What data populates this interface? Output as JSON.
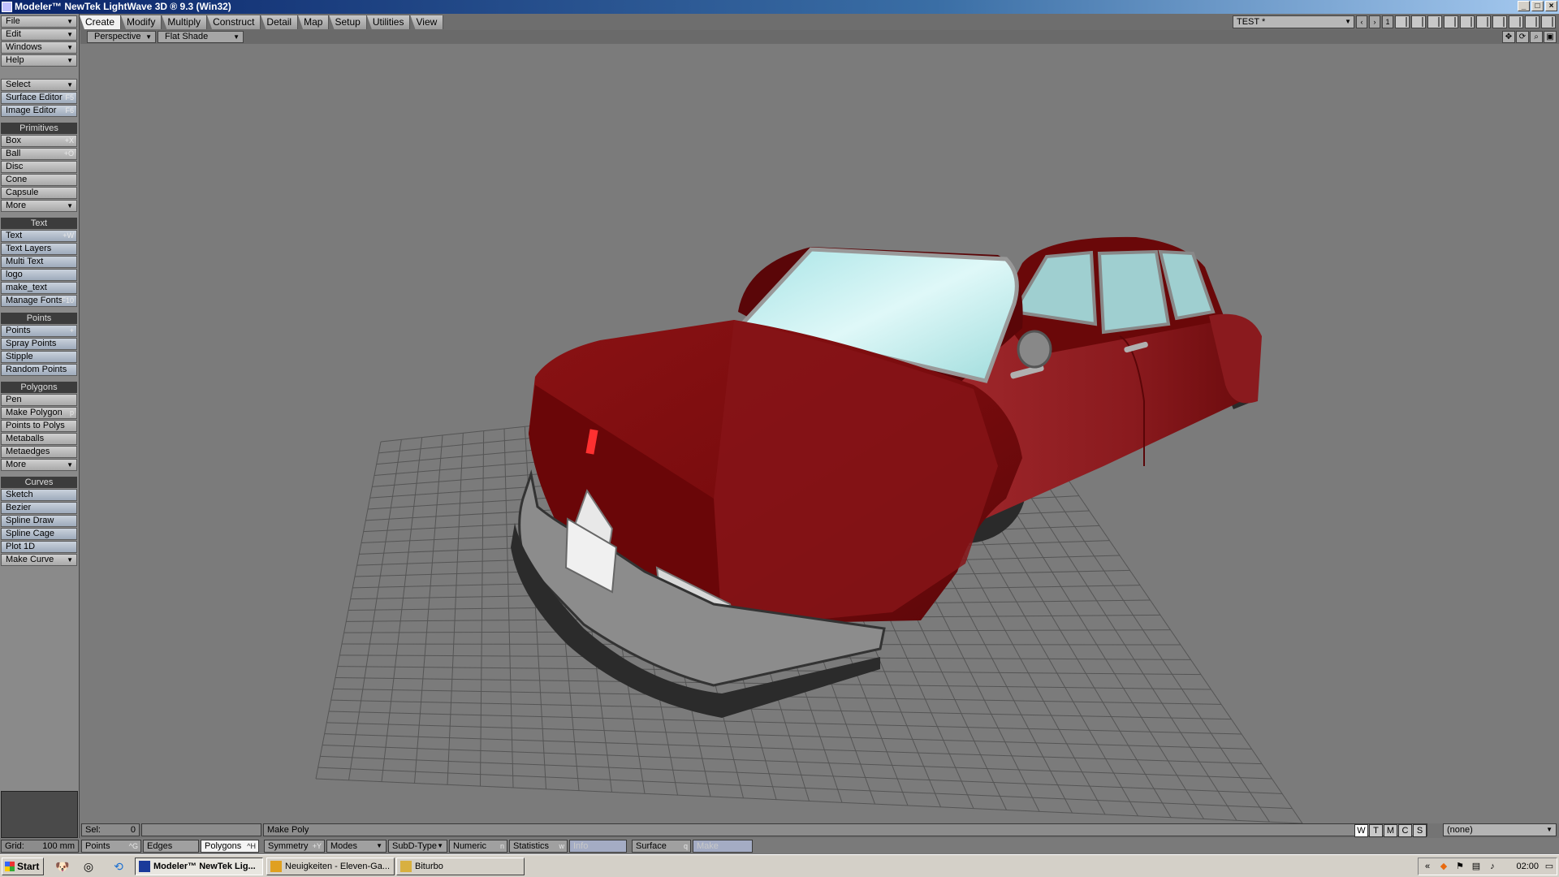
{
  "window": {
    "title": "Modeler™ NewTek LightWave 3D ® 9.3 (Win32)"
  },
  "tabs": [
    "Create",
    "Modify",
    "Multiply",
    "Construct",
    "Detail",
    "Map",
    "Setup",
    "Utilities",
    "View"
  ],
  "active_tab": "Create",
  "scene": {
    "name": "TEST *",
    "layer_number": "1"
  },
  "sidebar": {
    "top": [
      {
        "label": "File",
        "drop": true
      },
      {
        "label": "Edit",
        "drop": true
      },
      {
        "label": "Windows",
        "drop": true
      },
      {
        "label": "Help",
        "drop": true
      }
    ],
    "select": {
      "label": "Select"
    },
    "surface_editor": {
      "label": "Surface Editor",
      "key": "F5"
    },
    "image_editor": {
      "label": "Image Editor",
      "key": "F6"
    },
    "primitives": {
      "heading": "Primitives",
      "items": [
        {
          "label": "Box",
          "key": "+X"
        },
        {
          "label": "Ball",
          "key": "+O"
        },
        {
          "label": "Disc",
          "key": ""
        },
        {
          "label": "Cone",
          "key": ""
        },
        {
          "label": "Capsule",
          "key": ""
        },
        {
          "label": "More",
          "key": ""
        }
      ]
    },
    "text": {
      "heading": "Text",
      "items": [
        {
          "label": "Text",
          "key": "+W"
        },
        {
          "label": "Text Layers",
          "key": ""
        },
        {
          "label": "Multi Text",
          "key": ""
        },
        {
          "label": "logo",
          "key": ""
        },
        {
          "label": "make_text",
          "key": ""
        },
        {
          "label": "Manage Fonts",
          "key": "F10"
        }
      ]
    },
    "points": {
      "heading": "Points",
      "items": [
        {
          "label": "Points",
          "key": "+"
        },
        {
          "label": "Spray Points",
          "key": ""
        },
        {
          "label": "Stipple",
          "key": ""
        },
        {
          "label": "Random Points",
          "key": ""
        }
      ]
    },
    "polygons": {
      "heading": "Polygons",
      "items": [
        {
          "label": "Pen",
          "key": ""
        },
        {
          "label": "Make Polygon",
          "key": "p"
        },
        {
          "label": "Points to Polys",
          "key": ""
        },
        {
          "label": "Metaballs",
          "key": ""
        },
        {
          "label": "Metaedges",
          "key": ""
        },
        {
          "label": "More",
          "key": ""
        }
      ]
    },
    "curves": {
      "heading": "Curves",
      "items": [
        {
          "label": "Sketch",
          "key": ""
        },
        {
          "label": "Bezier",
          "key": ""
        },
        {
          "label": "Spline Draw",
          "key": ""
        },
        {
          "label": "Spline Cage",
          "key": ""
        },
        {
          "label": "Plot 1D",
          "key": ""
        },
        {
          "label": "Make Curve",
          "key": ""
        }
      ]
    }
  },
  "viewport": {
    "view_type": "Perspective",
    "shading": "Flat Shade"
  },
  "status": {
    "sel_label": "Sel:",
    "sel_value": "0",
    "info_text": "Make Poly",
    "view_toggles": [
      "W",
      "T",
      "M",
      "C",
      "S"
    ],
    "surface_select": "(none)",
    "grid_label": "Grid:",
    "grid_value": "100 mm",
    "modes": [
      {
        "label": "Points",
        "key": "^G"
      },
      {
        "label": "Edges",
        "key": ""
      },
      {
        "label": "Polygons",
        "key": "^H"
      }
    ],
    "buttons": [
      {
        "label": "Symmetry",
        "key": "+Y"
      },
      {
        "label": "Modes",
        "key": ""
      },
      {
        "label": "SubD-Type",
        "key": ""
      },
      {
        "label": "Numeric",
        "key": "n"
      },
      {
        "label": "Statistics",
        "key": "w"
      },
      {
        "label": "Info",
        "key": ""
      },
      {
        "label": "Surface",
        "key": "q"
      },
      {
        "label": "Make",
        "key": ""
      }
    ]
  },
  "taskbar": {
    "start": "Start",
    "tasks": [
      {
        "label": "Modeler™ NewTek Lig..."
      },
      {
        "label": "Neuigkeiten - Eleven-Ga..."
      },
      {
        "label": "Biturbo"
      }
    ],
    "clock": "02:00"
  },
  "colors": {
    "car_body": "#7a0c0e",
    "glass": "#bfeff0",
    "grid": "#5a5a5a",
    "viewport_bg": "#7b7b7b"
  }
}
